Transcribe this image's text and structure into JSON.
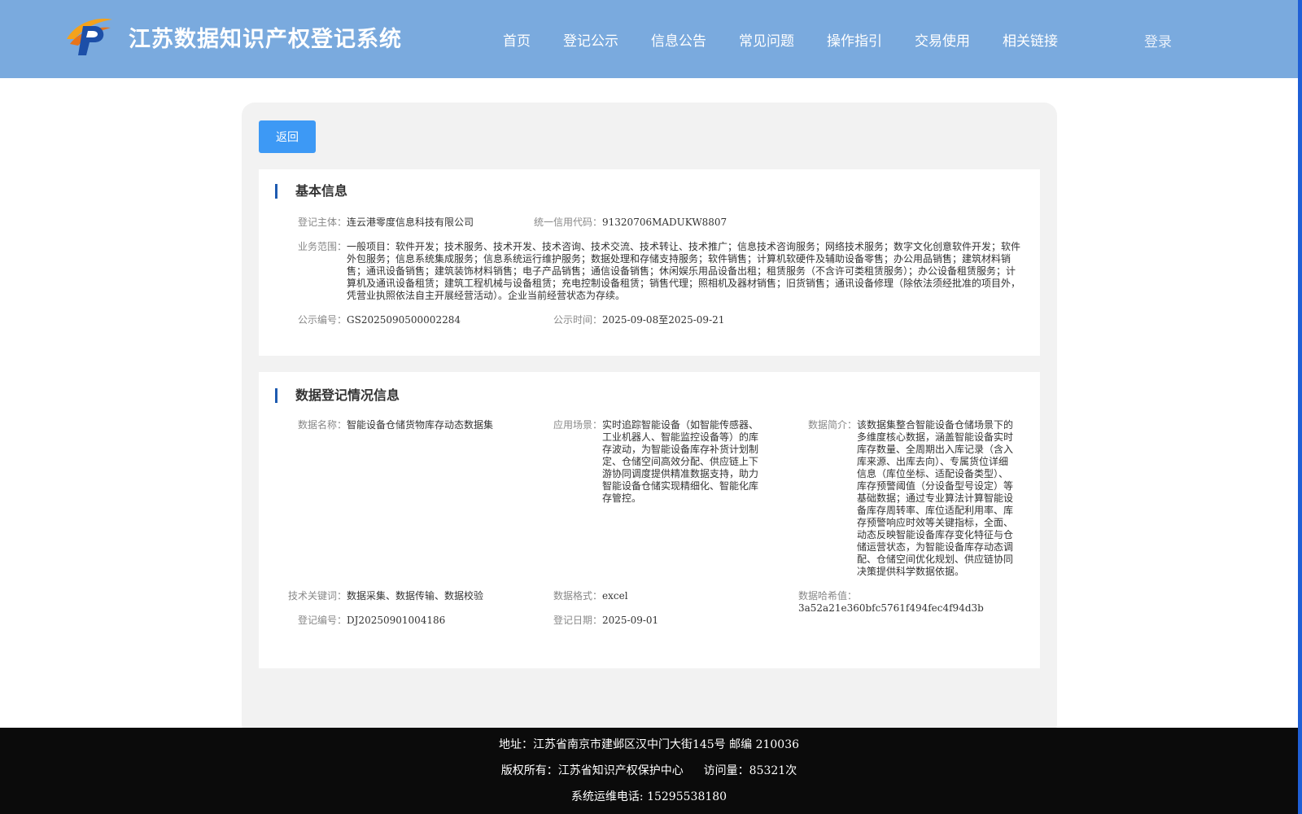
{
  "header": {
    "site_title": "江苏数据知识产权登记系统",
    "nav": [
      "首页",
      "登记公示",
      "信息公告",
      "常见问题",
      "操作指引",
      "交易使用",
      "相关链接"
    ],
    "login": "登录"
  },
  "back_label": "返回",
  "basic_info": {
    "title": "基本信息",
    "subject_label": "登记主体：",
    "subject": "连云港零度信息科技有限公司",
    "credit_code_label": "统一信用代码：",
    "credit_code": "91320706MADUKW8807",
    "scope_label": "业务范围：",
    "scope": "一般项目：软件开发；技术服务、技术开发、技术咨询、技术交流、技术转让、技术推广；信息技术咨询服务；网络技术服务；数字文化创意软件开发；软件外包服务；信息系统集成服务；信息系统运行维护服务；数据处理和存储支持服务；软件销售；计算机软硬件及辅助设备零售；办公用品销售；建筑材料销售；通讯设备销售；建筑装饰材料销售；电子产品销售；通信设备销售；休闲娱乐用品设备出租；租赁服务（不含许可类租赁服务）；办公设备租赁服务；计算机及通讯设备租赁；建筑工程机械与设备租赁；充电控制设备租赁；销售代理；照相机及器材销售；旧货销售；通讯设备修理（除依法须经批准的项目外，凭营业执照依法自主开展经营活动）。企业当前经营状态为存续。",
    "notice_no_label": "公示编号：",
    "notice_no": "GS2025090500002284",
    "notice_time_label": "公示时间：",
    "notice_time": "2025-09-08至2025-09-21"
  },
  "data_info": {
    "title": "数据登记情况信息",
    "name_label": "数据名称：",
    "name": "智能设备仓储货物库存动态数据集",
    "scene_label": "应用场景：",
    "scene": "实时追踪智能设备（如智能传感器、工业机器人、智能监控设备等）的库存波动，为智能设备库存补货计划制定、仓储空间高效分配、供应链上下游协同调度提供精准数据支持，助力智能设备仓储实现精细化、智能化库存管控。",
    "intro_label": "数据简介：",
    "intro": "该数据集整合智能设备仓储场景下的多维度核心数据，涵盖智能设备实时库存数量、全周期出入库记录（含入库来源、出库去向）、专属货位详细信息（库位坐标、适配设备类型）、库存预警阈值（分设备型号设定）等基础数据；通过专业算法计算智能设备库存周转率、库位适配利用率、库存预警响应时效等关键指标，全面、动态反映智能设备库存变化特征与仓储运营状态，为智能设备库存动态调配、仓储空间优化规划、供应链协同决策提供科学数据依据。",
    "keywords_label": "技术关键词：",
    "keywords": "数据采集、数据传输、数据校验",
    "format_label": "数据格式：",
    "format": "excel",
    "hash_label": "数据哈希值：",
    "hash": "3a52a21e360bfc5761f494fec4f94d3b",
    "reg_no_label": "登记编号：",
    "reg_no": "DJ20250901004186",
    "reg_date_label": "登记日期：",
    "reg_date": "2025-09-01"
  },
  "footer": {
    "address": "地址：江苏省南京市建邺区汉中门大街145号 邮编 210036",
    "copyright": "版权所有：江苏省知识产权保护中心",
    "visits": "访问量：85321次",
    "phone": "系统运维电话: 15295538180"
  }
}
